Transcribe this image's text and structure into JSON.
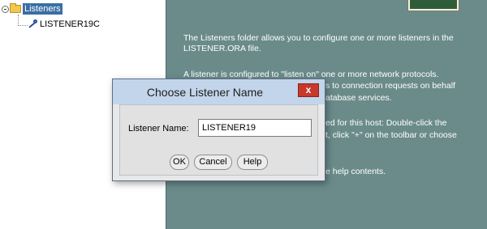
{
  "tree": {
    "root_label": "Listeners",
    "child_label": "LISTENER19C"
  },
  "info": {
    "paragraph_1": "The Listeners folder allows you to configure one or more listeners in the LISTENER.ORA file.",
    "paragraph_2_lines": [
      "A listener is configured to \"listen on\" one or more network protocols.",
      "s to connection requests on behalf",
      "atabase services."
    ],
    "paragraph_3_lines": [
      "ed for this host: Double-click the",
      "t, click \"+\" on the toolbar  or choose"
    ],
    "paragraph_4": "e help contents."
  },
  "dialog": {
    "title": "Choose Listener Name",
    "close_glyph": "x",
    "field_label": "Listener Name:",
    "field_value": "LISTENER19",
    "ok_label": "OK",
    "cancel_label": "Cancel",
    "help_label": "Help"
  },
  "colors": {
    "info_background": "#6b8b8b",
    "selection": "#3a6ea5",
    "title_bar": "#c2d5ea",
    "close_button": "#c6392b"
  },
  "icons": [
    "expand-collapse-icon",
    "folder-icon",
    "listener-key-icon",
    "chalkboard-icon",
    "close-icon"
  ]
}
